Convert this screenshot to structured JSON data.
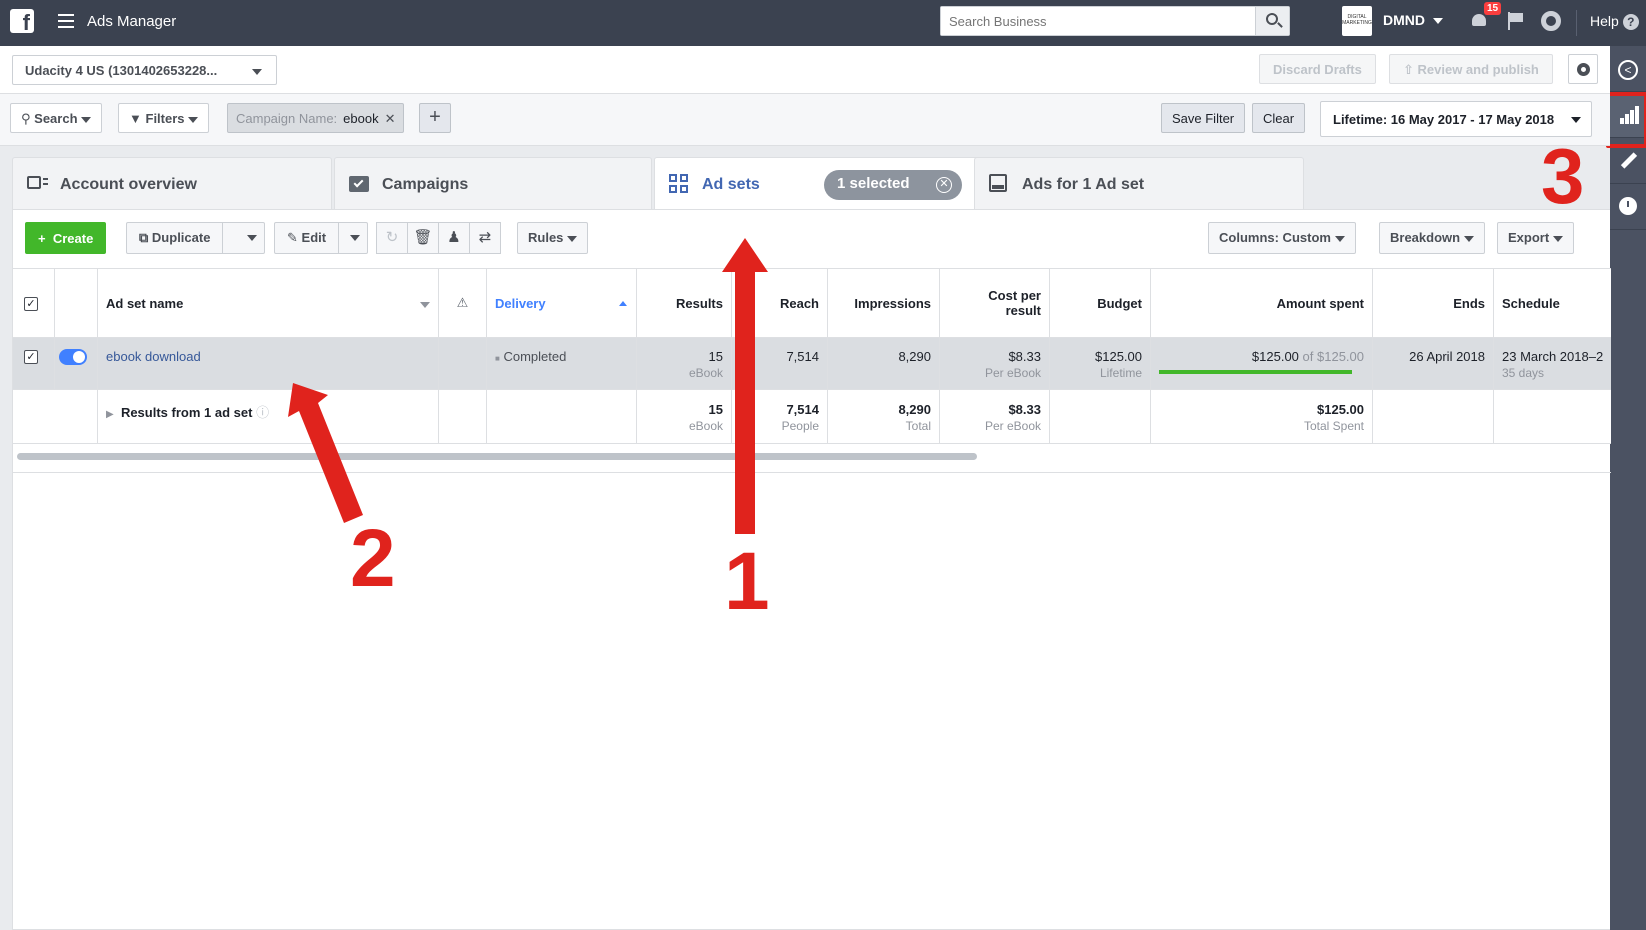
{
  "topbar": {
    "app_title": "Ads Manager",
    "search_placeholder": "Search Business",
    "business_name": "DMND",
    "business_logo_text": "DIGITAL MARKETING",
    "notification_count": "15",
    "help_label": "Help"
  },
  "account": {
    "selector_label": "Udacity 4 US (1301402653228...",
    "discard_label": "Discard Drafts",
    "review_label": "Review and publish"
  },
  "filters": {
    "search_label": "Search",
    "filters_label": "Filters",
    "chip_key": "Campaign Name:",
    "chip_value": "ebook",
    "save_filter_label": "Save Filter",
    "clear_label": "Clear",
    "date_range": "Lifetime: 16 May 2017 - 17 May 2018"
  },
  "tabs": [
    {
      "label": "Account overview"
    },
    {
      "label": "Campaigns"
    },
    {
      "label": "Ad sets",
      "selected_pill": "1 selected"
    },
    {
      "label": "Ads for 1 Ad set"
    }
  ],
  "toolbar": {
    "create": "Create",
    "duplicate": "Duplicate",
    "edit": "Edit",
    "rules": "Rules",
    "columns": "Columns: Custom",
    "breakdown": "Breakdown",
    "export": "Export"
  },
  "table": {
    "headers": {
      "name": "Ad set name",
      "delivery": "Delivery",
      "results": "Results",
      "reach": "Reach",
      "impressions": "Impressions",
      "cost_per_result_1": "Cost per",
      "cost_per_result_2": "result",
      "budget": "Budget",
      "amount_spent": "Amount spent",
      "ends": "Ends",
      "schedule": "Schedule"
    },
    "row": {
      "name": "ebook download",
      "delivery": "Completed",
      "results": "15",
      "results_sub": "eBook",
      "reach": "7,514",
      "impressions": "8,290",
      "cost": "$8.33",
      "cost_sub": "Per eBook",
      "budget": "$125.00",
      "budget_sub": "Lifetime",
      "spent": "$125.00",
      "spent_of": "of $125.00",
      "spent_fraction": 1.0,
      "ends": "26 April 2018",
      "schedule": "23 March 2018–2",
      "schedule_sub": "35 days"
    },
    "summary": {
      "label": "Results from 1 ad set",
      "results": "15",
      "results_sub": "eBook",
      "reach": "7,514",
      "reach_sub": "People",
      "impressions": "8,290",
      "impressions_sub": "Total",
      "cost": "$8.33",
      "cost_sub": "Per eBook",
      "spent": "$125.00",
      "spent_sub": "Total Spent"
    }
  },
  "annotations": {
    "one": "1",
    "two": "2",
    "three": "3",
    "color": "#e0231d"
  }
}
